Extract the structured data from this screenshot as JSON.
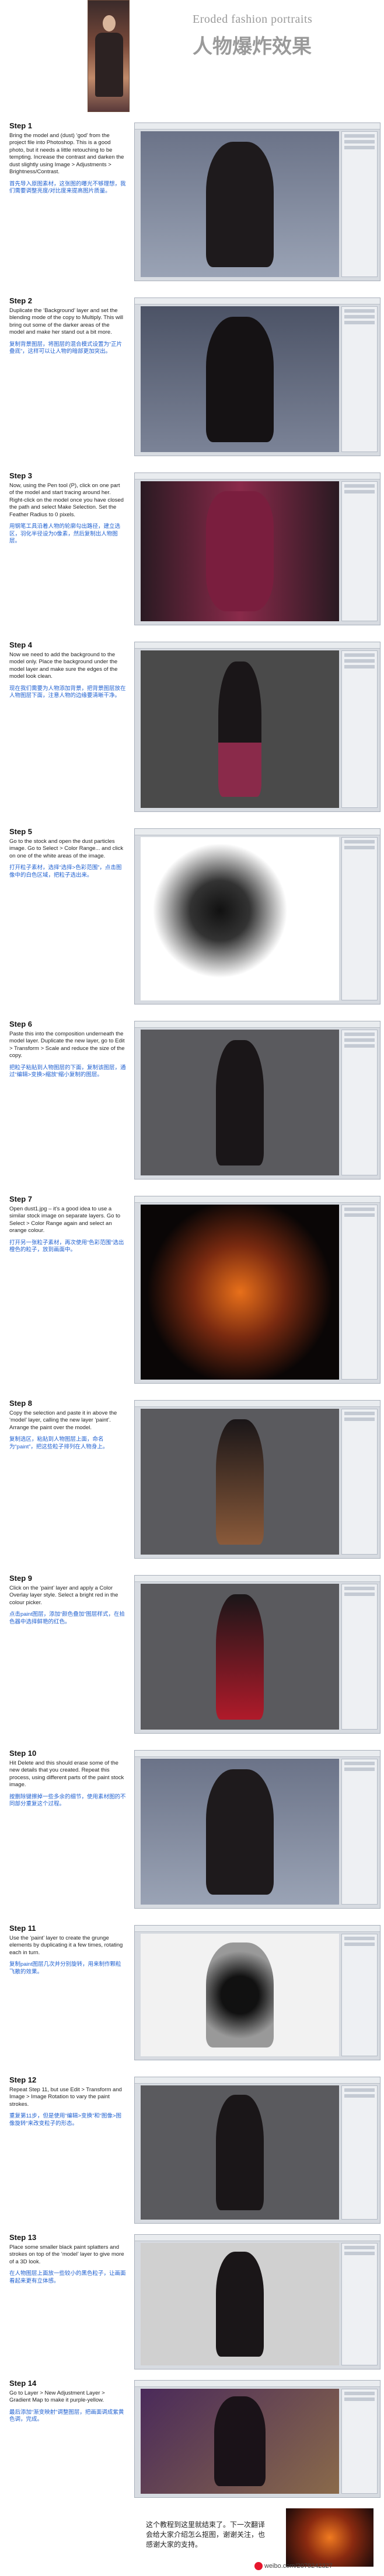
{
  "header": {
    "title_en": "Eroded fashion portraits",
    "title_cn": "人物爆炸效果"
  },
  "steps": [
    {
      "title": "Step 1",
      "en": "Bring the model and (dust) ‘god’ from the project file into Photoshop. This is a good photo, but it needs a little retouching to be tempting. Increase the contrast and darken the dust slightly using Image > Adjustments > Brightness/Contrast.",
      "cn": "首先导入原图素材，这张图的曝光不够理想，我们需要调整亮度/对比度来提高图片质量。"
    },
    {
      "title": "Step 2",
      "en": "Duplicate the ‘Background’ layer and set the blending mode of the copy to Multiply. This will bring out some of the darker areas of the model and make her stand out a bit more.",
      "cn": "复制背景图层，将图层的混合模式设置为“正片叠底”，这样可以让人物的暗部更加突出。"
    },
    {
      "title": "Step 3",
      "en": "Now, using the Pen tool (P), click on one part of the model and start tracing around her. Right-click on the model once you have closed the path and select Make Selection. Set the Feather Radius to 0 pixels.",
      "cn": "用钢笔工具沿着人物的轮廓勾出路径，建立选区，羽化半径设为0像素，然后复制出人物图层。"
    },
    {
      "title": "Step 4",
      "en": "Now we need to add the background to the model only. Place the background under the model layer and make sure the edges of the model look clean.",
      "cn": "现在我们需要为人物添加背景，把背景图层放在人物图层下面，注意人物的边缘要清晰干净。"
    },
    {
      "title": "Step 5",
      "en": "Go to the stock and open the dust particles image. Go to Select > Color Range... and click on one of the white areas of the image.",
      "cn": "打开粒子素材，选择“选择>色彩范围”，点击图像中的白色区域，把粒子选出来。"
    },
    {
      "title": "Step 6",
      "en": "Paste this into the composition underneath the model layer. Duplicate the new layer, go to Edit > Transform > Scale and reduce the size of the copy.",
      "cn": "把粒子粘贴到人物图层的下面，复制该图层，通过“编辑>变换>缩放”缩小复制的图层。"
    },
    {
      "title": "Step 7",
      "en": "Open dust1.jpg – it’s a good idea to use a similar stock image on separate layers. Go to Select > Color Range again and select an orange colour.",
      "cn": "打开另一张粒子素材，再次使用“色彩范围”选出橙色的粒子，放到画面中。"
    },
    {
      "title": "Step 8",
      "en": "Copy the selection and paste it in above the ‘model’ layer, calling the new layer ‘paint’. Arrange the paint over the model.",
      "cn": "复制选区，粘贴到人物图层上面，命名为“paint”，把这些粒子排列在人物身上。"
    },
    {
      "title": "Step 9",
      "en": "Click on the ‘paint’ layer and apply a Color Overlay layer style. Select a bright red in the colour picker.",
      "cn": "点击paint图层，添加“颜色叠加”图层样式，在拾色器中选择鲜艳的红色。"
    },
    {
      "title": "Step 10",
      "en": "Hit Delete and this should erase some of the new details that you created. Repeat this process, using different parts of the paint stock image.",
      "cn": "按删除键擦掉一些多余的细节，使用素材图的不同部分重复这个过程。"
    },
    {
      "title": "Step 11",
      "en": "Use the ‘paint’ layer to create the grunge elements by duplicating it a few times, rotating each in turn.",
      "cn": "复制paint图层几次并分别旋转，用来制作颗粒飞散的效果。"
    },
    {
      "title": "Step 12",
      "en": "Repeat Step 11, but use Edit > Transform and Image > Image Rotation to vary the paint strokes.",
      "cn": "重复第11步，但是使用“编辑>变换”和“图像>图像旋转”来改变粒子的形态。"
    },
    {
      "title": "Step 13",
      "en": "Place some smaller black paint splatters and strokes on top of the ‘model’ layer to give more of a 3D look.",
      "cn": "在人物图层上面放一些较小的黑色粒子，让画面看起来更有立体感。"
    },
    {
      "title": "Step 14",
      "en": "Go to Layer > New Adjustment Layer > Gradient Map to make it purple-yellow.",
      "cn": "最后添加“渐变映射”调整图层，把画面调成紫黄色调，完成。"
    }
  ],
  "footer": {
    "cn": "这个教程到这里就结束了。下一次翻译会给大家介绍怎么抠图，谢谢关注，也感谢大家的支持。",
    "watermark": "weibo.com/2079242327"
  }
}
